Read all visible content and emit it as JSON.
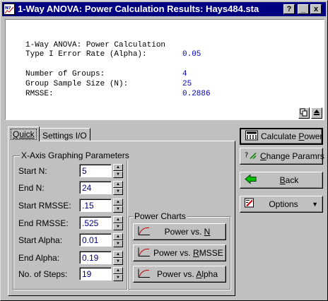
{
  "window": {
    "title": "1-Way ANOVA: Power Calculation Results: Hays484.sta",
    "controls": [
      "?",
      "_",
      "x"
    ]
  },
  "results": {
    "heading": "1-Way ANOVA: Power Calculation",
    "rows": [
      {
        "label": "Type I Error Rate (Alpha):",
        "value": "0.05"
      },
      {
        "label": "Number of Groups:",
        "value": "4"
      },
      {
        "label": "Group Sample Size (N):",
        "value": "25"
      },
      {
        "label": "RMSSE:",
        "value": "0.2886"
      }
    ]
  },
  "tabs": [
    {
      "label": "Quick",
      "active": true
    },
    {
      "label": "Settings I/O",
      "active": false
    }
  ],
  "xaxis": {
    "title": "X-Axis Graphing Parameters",
    "fields": [
      {
        "label": "Start N:",
        "value": "5"
      },
      {
        "label": "End N:",
        "value": "24"
      },
      {
        "label": "Start RMSSE:",
        "value": ".15"
      },
      {
        "label": "End RMSSE:",
        "value": ".525"
      },
      {
        "label": "Start Alpha:",
        "value": "0.01"
      },
      {
        "label": "End Alpha:",
        "value": "0.19"
      },
      {
        "label": "No. of Steps:",
        "value": "19"
      }
    ]
  },
  "power_charts": {
    "title": "Power Charts",
    "buttons": [
      {
        "pre": "Power vs. ",
        "key": "N",
        "post": ""
      },
      {
        "pre": "Power vs. ",
        "key": "R",
        "post": "MSSE"
      },
      {
        "pre": "Power vs. ",
        "key": "A",
        "post": "lpha"
      }
    ]
  },
  "actions": {
    "calculate": {
      "pre": "Calculate ",
      "key": "P",
      "post": "ower"
    },
    "change": {
      "pre": "",
      "key": "C",
      "post": "hange Paramrs"
    },
    "back": {
      "pre": "",
      "key": "B",
      "post": "ack"
    },
    "options": {
      "label": "Options"
    }
  },
  "colors": {
    "titlebar": "#000080",
    "value_text": "#0000c0",
    "face": "#c0c0c0"
  }
}
